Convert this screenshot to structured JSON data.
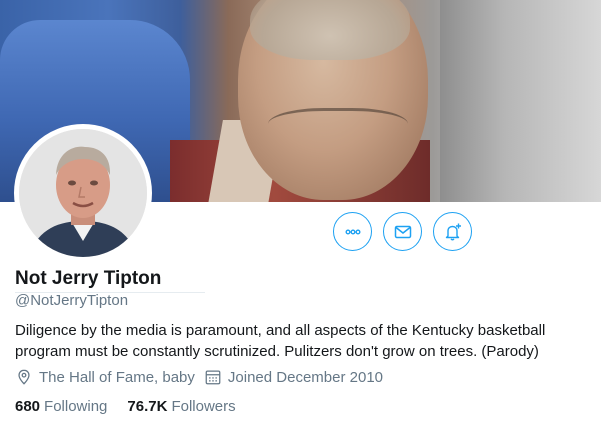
{
  "profile": {
    "display_name": "Not Jerry Tipton",
    "handle": "@NotJerryTipton",
    "bio": "Diligence by the media is paramount, and all aspects of the Kentucky basketball program must be constantly scrutinized. Pulitzers don't grow on trees. (Parody)",
    "location": "The Hall of Fame, baby",
    "joined": "Joined December 2010"
  },
  "stats": {
    "following_count": "680",
    "following_label": "Following",
    "followers_count": "76.7K",
    "followers_label": "Followers"
  },
  "actions": [
    {
      "name": "more-options",
      "icon": "ellipsis-icon"
    },
    {
      "name": "message",
      "icon": "envelope-icon"
    },
    {
      "name": "notifications",
      "icon": "bell-plus-icon"
    }
  ],
  "colors": {
    "accent": "#1da1f2",
    "secondary_text": "#657786",
    "primary_text": "#14171a"
  }
}
